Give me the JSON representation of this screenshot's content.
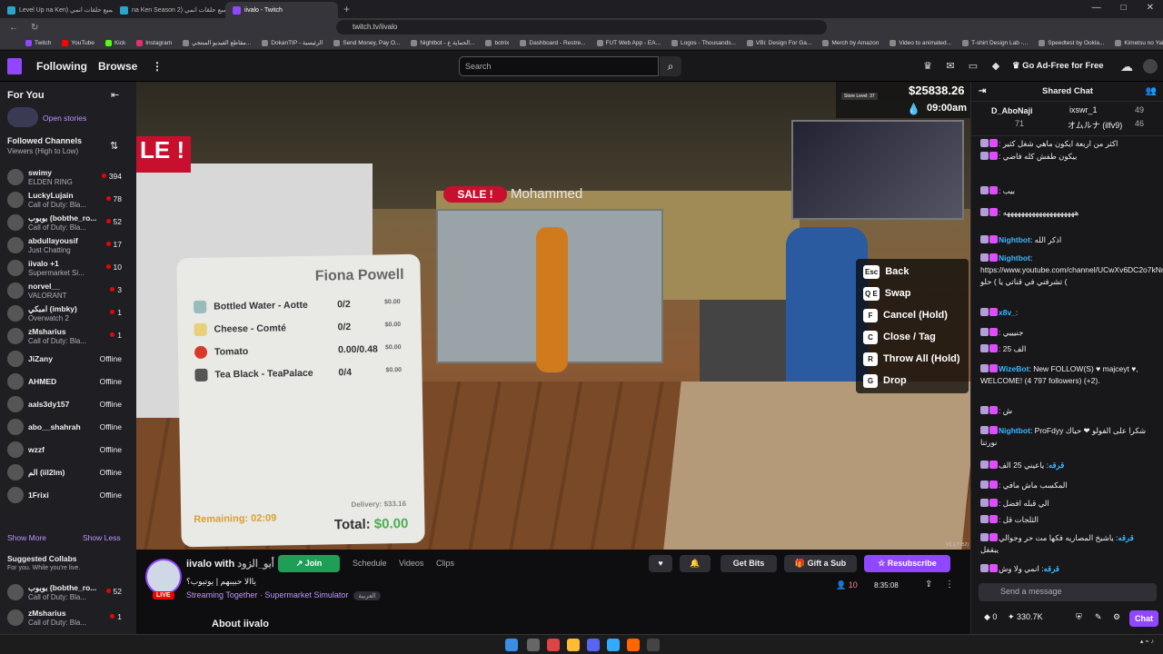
{
  "browser": {
    "tabs": [
      {
        "label": "Level Up na Ken) جميع حلقات انمي"
      },
      {
        "label": "na Ken Season 2) جميع حلقات انمي"
      },
      {
        "label": "iivalo - Twitch"
      }
    ],
    "url": "twitch.tv/iivalo",
    "bookmarks": [
      "Twitch",
      "YouTube",
      "Kick",
      "Instagram",
      "مقاطع الفيديو المنتجي...",
      "DokanTIP - الرئيسية",
      "Send Money, Pay O...",
      "Nightbot - الحماية ع...",
      "botrix",
      "Dashboard - Restre...",
      "FUT Web App - EA...",
      "Logos - Thousands...",
      "VBi: Design For Ga...",
      "Merch by Amazon",
      "Video to animated...",
      "T-shirt Design Lab -...",
      "Speedtest by Ookla...",
      "Kimetsu no Yai...انمي"
    ]
  },
  "topnav": {
    "following": "Following",
    "browse": "Browse",
    "search_placeholder": "Search",
    "adfree": "Go Ad-Free for Free"
  },
  "sidebar": {
    "for_you": "For You",
    "open_stories": "Open stories",
    "followed": "Followed Channels",
    "sort": "Viewers (High to Low)",
    "channels": [
      {
        "name": "swimy",
        "game": "ELDEN RING",
        "viewers": "394",
        "live": true
      },
      {
        "name": "LuckyLujain",
        "game": "Call of Duty: Bla...",
        "viewers": "78",
        "live": true
      },
      {
        "name": "بوبوب (bobthe_ro...",
        "game": "Call of Duty: Bla...",
        "viewers": "52",
        "live": true
      },
      {
        "name": "abdullayousif",
        "game": "Just Chatting",
        "viewers": "17",
        "live": true
      },
      {
        "name": "iivalo +1",
        "game": "Supermarket Si...",
        "viewers": "10",
        "live": true
      },
      {
        "name": "norvel__",
        "game": "VALORANT",
        "viewers": "3",
        "live": true
      },
      {
        "name": "امبكي (imbky)",
        "game": "Overwatch 2",
        "viewers": "1",
        "live": true
      },
      {
        "name": "zMsharius",
        "game": "Call of Duty: Bla...",
        "viewers": "1",
        "live": true
      },
      {
        "name": "JiZany",
        "game": "",
        "viewers": "Offline",
        "live": false
      },
      {
        "name": "AHMED",
        "game": "",
        "viewers": "Offline",
        "live": false
      },
      {
        "name": "aals3dy157",
        "game": "",
        "viewers": "Offline",
        "live": false
      },
      {
        "name": "abo__shahrah",
        "game": "",
        "viewers": "Offline",
        "live": false
      },
      {
        "name": "wzzf",
        "game": "",
        "viewers": "Offline",
        "live": false
      },
      {
        "name": "الم (iil2lm)",
        "game": "",
        "viewers": "Offline",
        "live": false
      },
      {
        "name": "1Frixi",
        "game": "",
        "viewers": "Offline",
        "live": false
      }
    ],
    "show_more": "Show More",
    "show_less": "Show Less",
    "suggested": "Suggested Collabs",
    "suggested_sub": "For you. While you're live.",
    "collabs": [
      {
        "name": "بوبوب (bobthe_ro...",
        "game": "Call of Duty: Bla...",
        "viewers": "52"
      },
      {
        "name": "zMsharius",
        "game": "Call of Duty: Bla...",
        "viewers": "1"
      }
    ]
  },
  "game": {
    "money": "$25838.26",
    "store_level": "Store Level: 37",
    "clock": "09:00am",
    "sale_left": "LE !",
    "sale_center": "SALE !",
    "npc_name": "Mohammed",
    "customer": "Fiona Powell",
    "items": [
      {
        "name": "Bottled Water - Aotte",
        "qty": "0/2",
        "price": "$0.00"
      },
      {
        "name": "Cheese - Comté",
        "qty": "0/2",
        "price": "$0.00"
      },
      {
        "name": "Tomato",
        "qty": "0.00/0.48",
        "price": "$0.00"
      },
      {
        "name": "Tea Black - TeaPalace",
        "qty": "0/4",
        "price": "$0.00"
      }
    ],
    "delivery": "Delivery: $33.16",
    "remaining": "Remaining: 02:09",
    "total_label": "Total:",
    "total_value": "$0.00",
    "controls": [
      {
        "key": "Esc",
        "label": "Back"
      },
      {
        "key": "Q E",
        "label": "Swap"
      },
      {
        "key": "F",
        "label": "Cancel (Hold)"
      },
      {
        "key": "C",
        "label": "Close / Tag"
      },
      {
        "key": "R",
        "label": "Throw All (Hold)"
      },
      {
        "key": "G",
        "label": "Drop"
      }
    ],
    "version": "V1.1.7 (52)"
  },
  "stream": {
    "channel": "iivalo",
    "with": "with",
    "partner": "أبو_الزود",
    "join": "Join",
    "tabs": [
      "Schedule",
      "Videos",
      "Clips"
    ],
    "title": "ياالا حبيبهم | يوتيوب؟",
    "category": "Streaming Together · Supermarket Simulator",
    "language": "العربية",
    "live": "LIVE",
    "get_bits": "Get Bits",
    "gift": "Gift a Sub",
    "resub": "Resubscribe",
    "viewers": "10",
    "uptime": "8:35:08",
    "about": "About iivalo"
  },
  "chat": {
    "header": "Shared Chat",
    "pinned": [
      {
        "name": "D_AboNaji",
        "count": "71"
      },
      {
        "name": "ixswr_1",
        "count": "49"
      },
      {
        "name": "オムルナ (ilfv9)",
        "count": "46"
      }
    ],
    "messages": [
      {
        "user": "",
        "text": "اكثر من اربعة ايكون ماهي شغل كثير"
      },
      {
        "user": "",
        "text": "بيكون طفش كله فاضي"
      },
      {
        "user": "",
        "text": "بيب"
      },
      {
        "user": "",
        "text": "ههههههههههههههههههههه"
      },
      {
        "user": "Nightbot",
        "text": "اذكر الله"
      },
      {
        "user": "Nightbot",
        "text": "https://www.youtube.com/channel/UCwXv6DC2o7kNmGVxmNPhRJA تشرفني في قناتي يا ) حلو ("
      },
      {
        "user": "x8v_",
        "text": ""
      },
      {
        "user": "",
        "text": "جنيييي"
      },
      {
        "user": "",
        "text": "الف 25"
      },
      {
        "user": "WizeBot",
        "text": "New FOLLOW(S) ♥ majceyt ♥, WELCOME! (4 797 followers) (+2)."
      },
      {
        "user": "",
        "text": "ش"
      },
      {
        "user": "Nightbot",
        "text": "ProFdyy شكرا على الفولو ❤ حياك نورتنا"
      },
      {
        "user": "قرقه",
        "text": "ياعيني 25 الف"
      },
      {
        "user": "",
        "text": "المكسب ماش مافي"
      },
      {
        "user": "",
        "text": "الي قبله افضل"
      },
      {
        "user": "",
        "text": "الثلجات قل"
      },
      {
        "user": "قرقه",
        "text": "ياشيخ المصاريه فكها مت حر وجوالي يبقفل"
      },
      {
        "user": "قرقه",
        "text": "انمي ولا وش"
      }
    ],
    "input_placeholder": "Send a message",
    "bits": "0",
    "points": "330.7K",
    "chat_button": "Chat"
  }
}
